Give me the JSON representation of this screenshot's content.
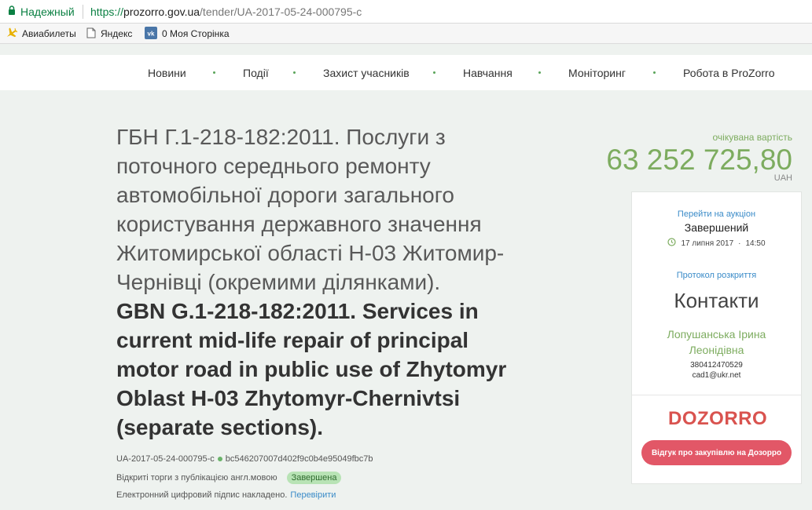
{
  "browser": {
    "secure_label": "Надежный",
    "url_protocol": "https://",
    "url_host": "prozorro.gov.ua",
    "url_path": "/tender/UA-2017-05-24-000795-c",
    "bookmarks": [
      {
        "label": "Авиабилеты",
        "icon": "plane-icon"
      },
      {
        "label": "Яндекс",
        "icon": "page-icon"
      },
      {
        "label": "0 Моя Сторінка",
        "icon": "vk-icon"
      }
    ]
  },
  "nav": {
    "items": [
      "Новини",
      "Події",
      "Захист учасників",
      "Навчання",
      "Моніторинг",
      "Робота в ProZorro"
    ]
  },
  "tender": {
    "title_ua": "ГБН Г.1-218-182:2011. Послуги з поточного середнього ремонту автомобільної дороги загального користування державного значення Житомирської області Н-03 Житомир-Чернівці (окремими ділянками).",
    "title_en": "GBN G.1-218-182:2011. Services in current mid-life repair of principal motor road in public use of Zhytomyr Oblast H-03 Zhytomyr-Chernivtsi (separate sections).",
    "tender_id": "UA-2017-05-24-000795-c",
    "hash": "bc546207007d402f9c0b4e95049fbc7b",
    "procedure": "Відкриті торги з публікацією англ.мовою",
    "status": "Завершена",
    "signature_text": "Електронний цифровий підпис накладено.",
    "verify_link": "Перевірити"
  },
  "value": {
    "label": "очікувана вартість",
    "amount": "63 252 725,80",
    "currency": "UAH"
  },
  "card": {
    "auction_link": "Перейти на аукціон",
    "auction_status": "Завершений",
    "auction_date": "17 липня 2017",
    "auction_time": "14:50",
    "protocol_link": "Протокол розкриття",
    "contacts_title": "Контакти",
    "contact_name_line1": "Лопушанська Ірина",
    "contact_name_line2": "Леонідівна",
    "contact_phone": "380412470529",
    "contact_email": "cad1@ukr.net",
    "dozorro_logo": "DOZORRO",
    "dozorro_button": "Відгук про закупівлю на Дозорро"
  },
  "colors": {
    "accent_green": "#7dac5f",
    "link_blue": "#3a8bc8",
    "dozorro_red": "#e25767",
    "page_bg": "#eef2ef"
  }
}
